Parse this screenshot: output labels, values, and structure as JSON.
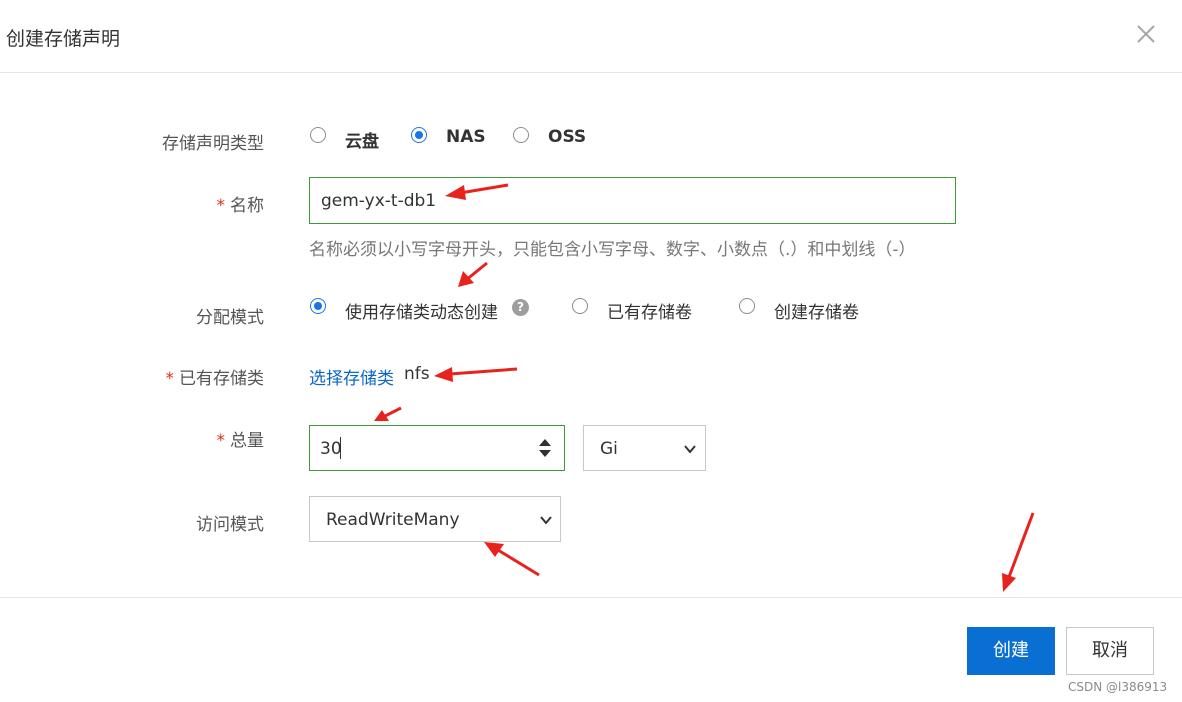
{
  "dialog": {
    "title": "创建存储声明"
  },
  "form": {
    "type": {
      "label": "存储声明类型",
      "options": [
        "云盘",
        "NAS",
        "OSS"
      ],
      "selected": "NAS"
    },
    "name": {
      "label": "名称",
      "required_mark": "*",
      "value": "gem-yx-t-db1",
      "hint": "名称必须以小写字母开头，只能包含小写字母、数字、小数点（.）和中划线（-）"
    },
    "allocation": {
      "label": "分配模式",
      "options": [
        "使用存储类动态创建",
        "已有存储卷",
        "创建存储卷"
      ],
      "selected": "使用存储类动态创建",
      "help_glyph": "?"
    },
    "storage_class": {
      "label": "已有存储类",
      "required_mark": "*",
      "link_text": "选择存储类",
      "value": "nfs"
    },
    "capacity": {
      "label": "总量",
      "required_mark": "*",
      "value": "30",
      "unit": "Gi"
    },
    "access_mode": {
      "label": "访问模式",
      "value": "ReadWriteMany"
    }
  },
  "footer": {
    "create_label": "创建",
    "cancel_label": "取消"
  },
  "watermark": "CSDN @l386913",
  "colors": {
    "primary": "#0a6fd3",
    "link": "#0b67c6",
    "required": "#e0301e",
    "input_border_active": "#3c9a3c",
    "annotation_arrow": "#e8221c"
  },
  "icons": [
    "close-icon",
    "help-icon",
    "chevron-down-icon",
    "spinner-icon",
    "annotation-arrow"
  ]
}
